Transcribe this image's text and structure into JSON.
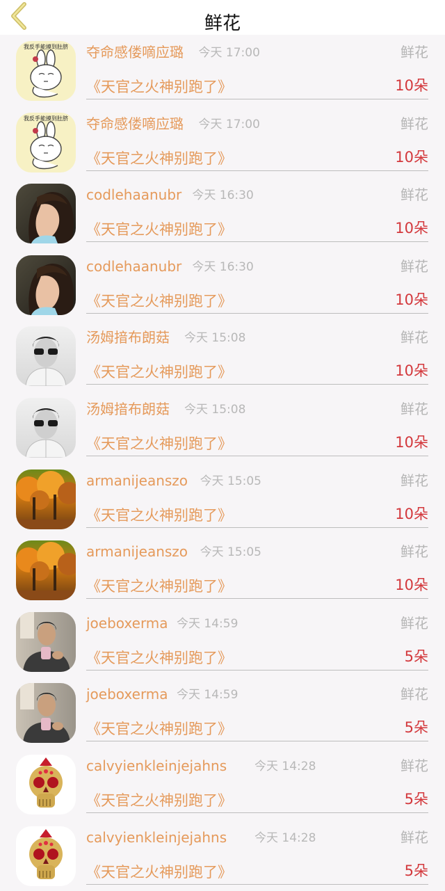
{
  "header": {
    "title": "鲜花",
    "back_icon": "chevron-left-icon"
  },
  "rows": [
    {
      "avatar": "cartoon-rabbit",
      "avatar_text": "我反手能摸到肚脐",
      "name": "夺命感偻嘀应璐",
      "time": "今天 17:00",
      "gift": "鲜花",
      "book": "《天官之火神别跑了》",
      "count": "10朵"
    },
    {
      "avatar": "cartoon-rabbit",
      "avatar_text": "我反手能摸到肚脐",
      "name": "夺命感偻嘀应璐",
      "time": "今天 17:00",
      "gift": "鲜花",
      "book": "《天官之火神别跑了》",
      "count": "10朵"
    },
    {
      "avatar": "girl-profile",
      "name": "codlehaanubr",
      "time": "今天 16:30",
      "gift": "鲜花",
      "book": "《天官之火神别跑了》",
      "count": "10朵"
    },
    {
      "avatar": "girl-profile",
      "name": "codlehaanubr",
      "time": "今天 16:30",
      "gift": "鲜花",
      "book": "《天官之火神别跑了》",
      "count": "10朵"
    },
    {
      "avatar": "man-sunglasses-bw",
      "name": "汤姆揞布朗菇",
      "time": "今天 15:08",
      "gift": "鲜花",
      "book": "《天官之火神别跑了》",
      "count": "10朵"
    },
    {
      "avatar": "man-sunglasses-bw",
      "name": "汤姆揞布朗菇",
      "time": "今天 15:08",
      "gift": "鲜花",
      "book": "《天官之火神别跑了》",
      "count": "10朵"
    },
    {
      "avatar": "autumn-trees",
      "name": "armanijeanszo",
      "time": "今天 15:05",
      "gift": "鲜花",
      "book": "《天官之火神别跑了》",
      "count": "10朵"
    },
    {
      "avatar": "autumn-trees",
      "name": "armanijeanszo",
      "time": "今天 15:05",
      "gift": "鲜花",
      "book": "《天官之火神别跑了》",
      "count": "10朵"
    },
    {
      "avatar": "man-with-phone",
      "name": "joeboxerma",
      "time": "今天 14:59",
      "gift": "鲜花",
      "book": "《天官之火神别跑了》",
      "count": "5朵"
    },
    {
      "avatar": "man-with-phone",
      "name": "joeboxerma",
      "time": "今天 14:59",
      "gift": "鲜花",
      "book": "《天官之火神别跑了》",
      "count": "5朵"
    },
    {
      "avatar": "jeweled-skull",
      "name": "calvyienkleinjejahns",
      "time": "今天 14:28",
      "gift": "鲜花",
      "book": "《天官之火神别跑了》",
      "count": "5朵"
    },
    {
      "avatar": "jeweled-skull",
      "name": "calvyienkleinjejahns",
      "time": "今天 14:28",
      "gift": "鲜花",
      "book": "《天官之火神别跑了》",
      "count": "5朵"
    }
  ],
  "colors": {
    "name": "#e59a5b",
    "count": "#d3383c",
    "time": "#b8b8b8",
    "background": "#f7f5f7"
  }
}
